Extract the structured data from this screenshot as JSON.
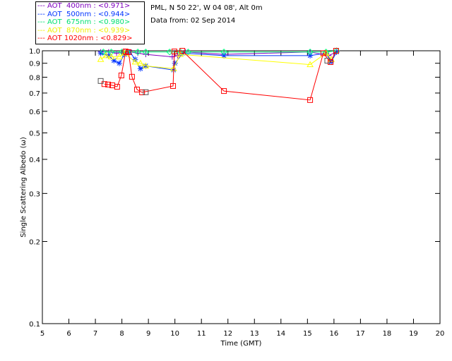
{
  "header": {
    "location": "PML, N 50 22', W 04 08', Alt 0m",
    "date": "Data from: 02 Sep 2014"
  },
  "chart_data": {
    "type": "scatter",
    "xlabel": "Time (GMT)",
    "ylabel": "Single Scattering Albedo (ω)",
    "xlim": [
      5,
      20
    ],
    "ylim": [
      0.1,
      1.0
    ],
    "yscale": "log",
    "grid": false,
    "legend_position": "top-left (outside)",
    "xticks": [
      "5",
      "6",
      "7",
      "8",
      "9",
      "10",
      "11",
      "12",
      "13",
      "14",
      "15",
      "16",
      "17",
      "18",
      "19",
      "20"
    ],
    "yticks": [
      "1.0",
      "0.9",
      "0.8",
      "0.7",
      "0.6",
      "0.5",
      "0.4",
      "0.3",
      "0.2",
      "0.1"
    ],
    "series": [
      {
        "name": "AOT  400nm : <0.971>",
        "color": "#7f00bf",
        "marker": "plus",
        "x": [
          7.2,
          7.5,
          7.8,
          8.1,
          8.3,
          8.6,
          8.9,
          9.9,
          10.1,
          10.4,
          11.85,
          15.1,
          15.8,
          16.1
        ],
        "y": [
          0.99,
          0.99,
          0.98,
          0.99,
          0.99,
          0.98,
          0.97,
          0.95,
          0.96,
          0.99,
          0.97,
          0.99,
          0.96,
          0.99
        ]
      },
      {
        "name": "AOT  500nm : <0.944>",
        "color": "#0033ff",
        "marker": "star",
        "x": [
          7.2,
          7.5,
          7.7,
          7.9,
          8.1,
          8.3,
          8.5,
          8.7,
          8.9,
          9.95,
          10.0,
          10.3,
          11.85,
          15.1,
          15.7,
          15.9,
          16.1
        ],
        "y": [
          0.98,
          0.96,
          0.92,
          0.9,
          0.97,
          0.99,
          0.93,
          0.86,
          0.88,
          0.85,
          0.9,
          0.98,
          0.96,
          0.96,
          0.98,
          0.91,
          0.99
        ]
      },
      {
        "name": "AOT  675nm : <0.980>",
        "color": "#00ff80",
        "marker": "diamond",
        "x": [
          7.3,
          7.6,
          8.0,
          8.2,
          8.6,
          8.9,
          9.8,
          10.2,
          10.5,
          11.85,
          15.1,
          15.7,
          16.1
        ],
        "y": [
          0.99,
          0.99,
          0.99,
          0.99,
          0.99,
          0.99,
          0.99,
          0.99,
          0.99,
          0.99,
          0.99,
          0.99,
          1.0
        ]
      },
      {
        "name": "AOT  870nm : <0.939>",
        "color": "#ffff00",
        "marker": "triangle",
        "x": [
          7.2,
          7.4,
          7.6,
          7.9,
          8.1,
          8.5,
          8.7,
          8.9,
          9.95,
          10.2,
          15.1,
          15.7,
          15.9
        ],
        "y": [
          0.93,
          0.96,
          0.95,
          0.95,
          0.98,
          0.91,
          0.9,
          0.88,
          0.86,
          0.97,
          0.89,
          0.98,
          0.93
        ]
      },
      {
        "name": "AOT 1020nm : <0.829>",
        "color": "#ff0000",
        "marker": "square",
        "x": [
          7.34,
          7.48,
          7.64,
          7.82,
          7.98,
          8.14,
          8.25,
          8.38,
          8.57,
          8.76,
          9.93,
          9.98,
          10.28,
          11.85,
          15.1,
          15.6,
          15.87,
          16.08
        ],
        "y": [
          0.755,
          0.752,
          0.747,
          0.738,
          0.812,
          0.994,
          0.988,
          0.803,
          0.721,
          0.704,
          0.743,
          0.994,
          1.0,
          0.712,
          0.66,
          0.98,
          0.909,
          1.0
        ]
      },
      {
        "color": "#555555",
        "marker": "square",
        "x": [
          7.2,
          8.9,
          15.75
        ],
        "y": [
          0.775,
          0.705,
          0.92
        ]
      }
    ]
  }
}
